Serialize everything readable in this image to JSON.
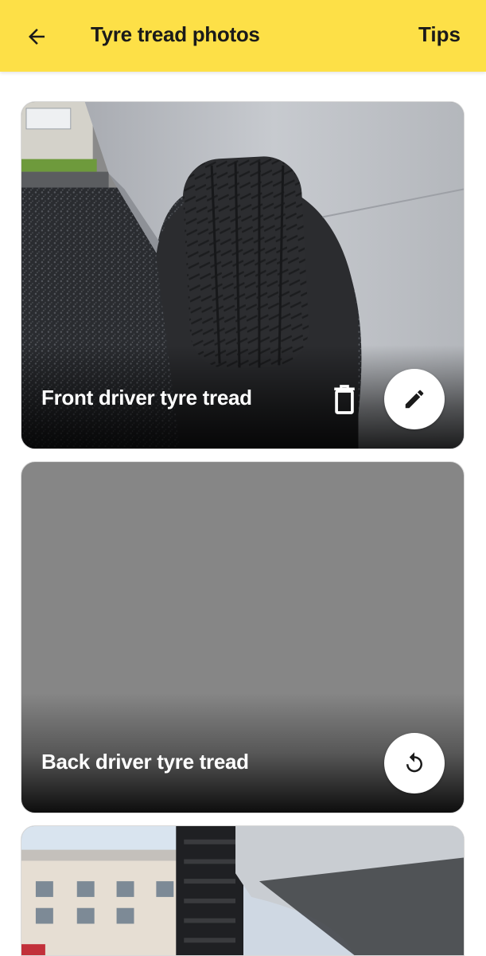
{
  "appbar": {
    "title": "Tyre tread photos",
    "tips_label": "Tips",
    "back_icon": "arrow-left-icon",
    "background": "#fde047"
  },
  "cards": [
    {
      "label": "Front driver tyre tread",
      "state": "photo-taken",
      "actions": [
        "delete-icon",
        "pencil-icon"
      ]
    },
    {
      "label": "Back driver tyre tread",
      "state": "placeholder",
      "actions": [
        "retake-icon"
      ]
    },
    {
      "label": "",
      "state": "photo-taken",
      "actions": []
    }
  ]
}
